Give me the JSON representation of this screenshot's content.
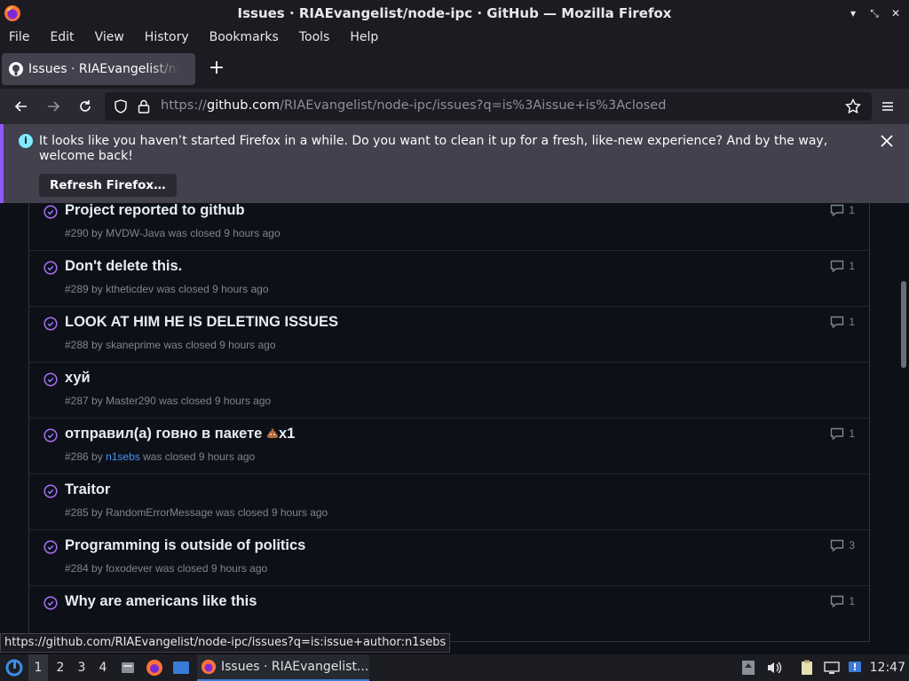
{
  "window": {
    "title": "Issues · RIAEvangelist/node-ipc · GitHub — Mozilla Firefox"
  },
  "menu": [
    "File",
    "Edit",
    "View",
    "History",
    "Bookmarks",
    "Tools",
    "Help"
  ],
  "tab": {
    "title": "Issues · RIAEvangelist/node-ipc"
  },
  "nav": {
    "url_prefix": "https://",
    "url_domain": "github.com",
    "url_path": "/RIAEvangelist/node-ipc/issues?q=is%3Aissue+is%3Aclosed"
  },
  "notification": {
    "message": "It looks like you haven’t started Firefox in a while. Do you want to clean it up for a fresh, like-new experience? And by the way, welcome back!",
    "button": "Refresh Firefox…"
  },
  "issues": [
    {
      "title": "Project reported to github",
      "number": "#290",
      "by": "by",
      "author": "MVDW-Java",
      "status": "was closed 9 hours ago",
      "comments": "1",
      "author_link": false
    },
    {
      "title": "Don't delete this.",
      "number": "#289",
      "by": "by",
      "author": "ktheticdev",
      "status": "was closed 9 hours ago",
      "comments": "1",
      "author_link": false
    },
    {
      "title": "LOOK AT HIM HE IS DELETING ISSUES",
      "number": "#288",
      "by": "by",
      "author": "skaneprime",
      "status": "was closed 9 hours ago",
      "comments": "1",
      "author_link": false
    },
    {
      "title": "хуй",
      "number": "#287",
      "by": "by",
      "author": "Master290",
      "status": "was closed 9 hours ago",
      "comments": "",
      "author_link": false
    },
    {
      "title": "отправил(а) говно в пакете",
      "title_suffix": "x1",
      "number": "#286",
      "by": "by",
      "author": "n1sebs",
      "status": "was closed 9 hours ago",
      "comments": "1",
      "author_link": true
    },
    {
      "title": "Traitor",
      "number": "#285",
      "by": "by",
      "author": "RandomErrorMessage",
      "status": "was closed 9 hours ago",
      "comments": "",
      "author_link": false
    },
    {
      "title": "Programming is outside of politics",
      "number": "#284",
      "by": "by",
      "author": "foxodever",
      "status": "was closed 9 hours ago",
      "comments": "3",
      "author_link": false
    },
    {
      "title": "Why are americans like this",
      "number": "",
      "by": "",
      "author": "",
      "status": "",
      "comments": "1",
      "author_link": false
    }
  ],
  "status_link": "https://github.com/RIAEvangelist/node-ipc/issues?q=is:issue+author:n1sebs",
  "taskbar": {
    "workspaces": [
      "1",
      "2",
      "3",
      "4"
    ],
    "active_task": "Issues · RIAEvangelist...",
    "clock": "12:47"
  },
  "colors": {
    "accent": "#9059ff",
    "closed_icon": "#a371f7",
    "link": "#4493f8"
  }
}
